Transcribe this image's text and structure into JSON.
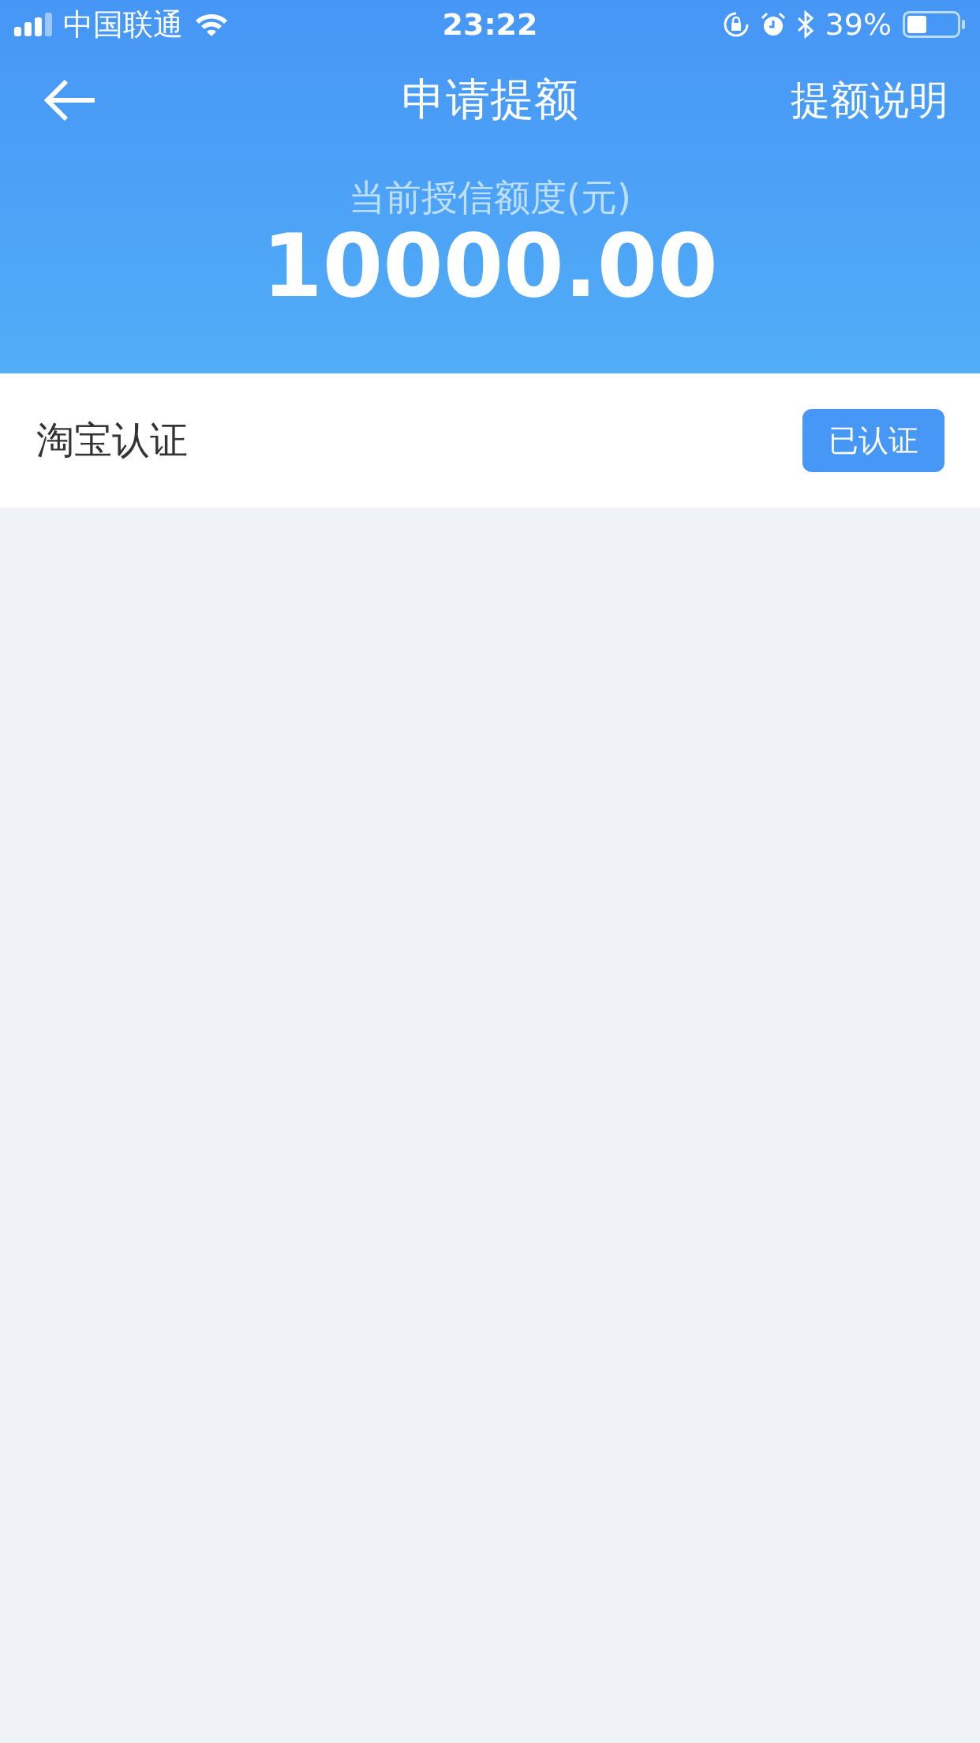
{
  "status_bar": {
    "carrier": "中国联通",
    "time": "23:22",
    "battery": "39%"
  },
  "nav": {
    "title": "申请提额",
    "action": "提额说明"
  },
  "credit": {
    "label": "当前授信额度(元)",
    "amount": "10000.00"
  },
  "certifications": [
    {
      "label": "淘宝认证",
      "status": "已认证"
    }
  ]
}
